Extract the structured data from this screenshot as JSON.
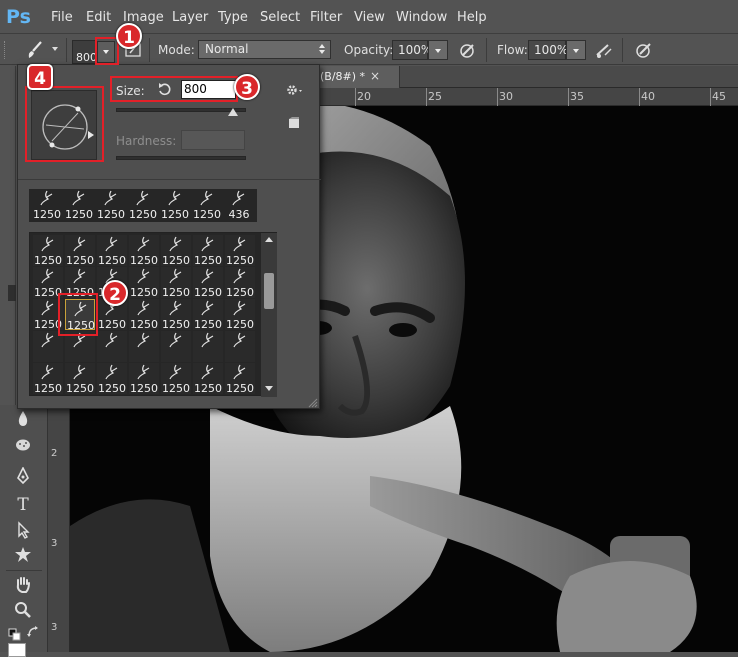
{
  "app": {
    "logo": "Ps"
  },
  "menu": [
    "File",
    "Edit",
    "Image",
    "Layer",
    "Type",
    "Select",
    "Filter",
    "View",
    "Window",
    "Help"
  ],
  "options": {
    "brush_size": "800",
    "mode_label": "Mode:",
    "mode_value": "Normal",
    "opacity_label": "Opacity:",
    "opacity_value": "100%",
    "flow_label": "Flow:",
    "flow_value": "100%"
  },
  "document_tab": {
    "title": "(B/8#) *",
    "close": "×"
  },
  "ruler": {
    "top_labels": [
      "20",
      "25",
      "30",
      "35",
      "40",
      "45"
    ],
    "left_labels": [
      "2",
      "3",
      "3"
    ]
  },
  "brush_panel": {
    "size_label": "Size:",
    "size_value": "800",
    "hardness_label": "Hardness:",
    "recent_brushes": [
      "1250",
      "1250",
      "1250",
      "1250",
      "1250",
      "1250",
      "436"
    ],
    "grid_rows": [
      [
        "1250",
        "1250",
        "1250",
        "1250",
        "1250",
        "1250",
        "1250"
      ],
      [
        "1250",
        "1250",
        "1250",
        "1250",
        "1250",
        "1250",
        "1250"
      ],
      [
        "1250",
        "1250",
        "1250",
        "1250",
        "1250",
        "1250",
        "1250"
      ],
      [
        "",
        "",
        "",
        "",
        "",
        "",
        ""
      ],
      [
        "1250",
        "1250",
        "1250",
        "1250",
        "1250",
        "1250",
        "1250"
      ]
    ]
  },
  "callouts": [
    "1",
    "2",
    "3",
    "4"
  ],
  "colors": {
    "ui_bg": "#535353",
    "panel_bg": "#4f4f4f",
    "callout_red": "#d9282b",
    "ps_blue": "#63b7f5"
  },
  "icons": [
    "brush-icon",
    "brush-panel-toggle-icon",
    "airbrush-icon",
    "pressure-opacity-icon",
    "pressure-size-icon",
    "reset-size-icon",
    "gear-icon",
    "new-preset-icon",
    "scroll-up-icon",
    "scroll-down-icon"
  ]
}
